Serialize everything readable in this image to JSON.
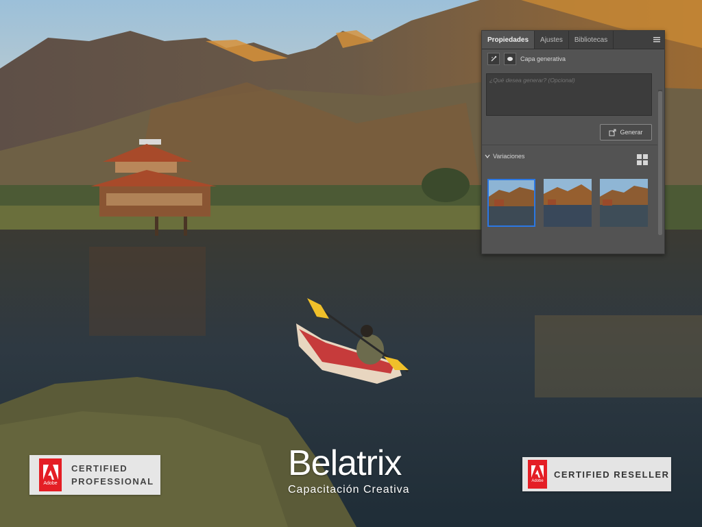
{
  "panel": {
    "tabs": [
      "Propiedades",
      "Ajustes",
      "Bibliotecas"
    ],
    "layer_name": "Capa generativa",
    "prompt_placeholder": "¿Qué desea generar? (Opcional)",
    "generate_label": "Generar",
    "variations_label": "Variaciones",
    "selected_variation": 1
  },
  "brand": {
    "name": "Belatrix",
    "tagline": "Capacitación Creativa"
  },
  "badges": {
    "professional": {
      "logo_text": "Adobe",
      "line1": "CERTIFIED",
      "line2": "PROFESSIONAL"
    },
    "reseller": {
      "logo_text": "Adobe",
      "text": "CERTIFIED RESELLER"
    }
  },
  "colors": {
    "accent": "#2b78e4",
    "adobe_red": "#e41e25",
    "panel_bg": "#535353"
  }
}
